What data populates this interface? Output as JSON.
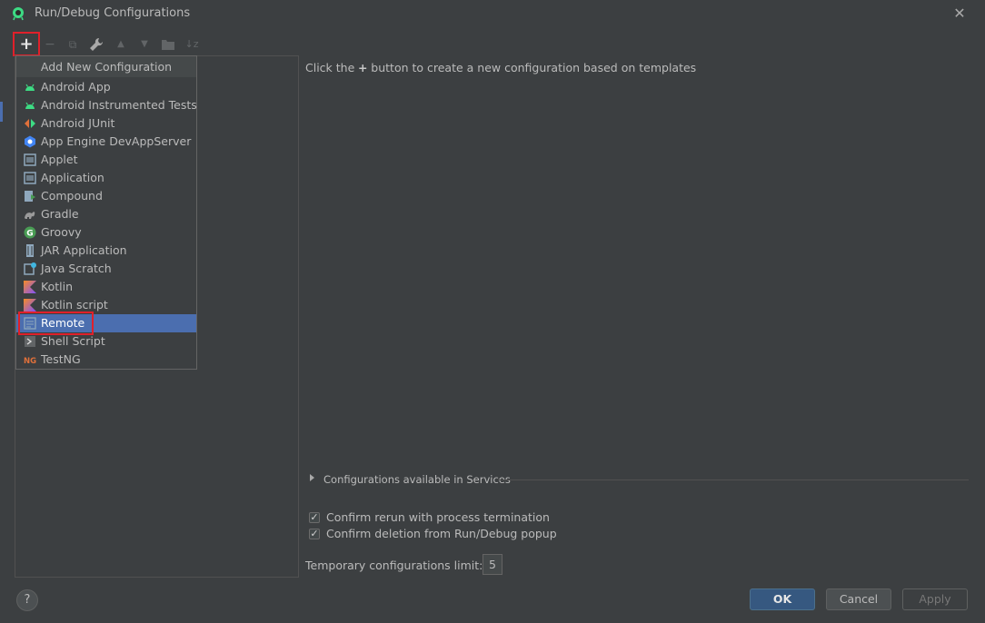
{
  "window": {
    "title": "Run/Debug Configurations",
    "close_glyph": "✕"
  },
  "toolbar": {
    "add": "+",
    "remove": "−",
    "copy": "⧉",
    "edit_templates": "🔧",
    "move_up": "▲",
    "move_down": "▼",
    "folder": "📁",
    "sort": "↓z"
  },
  "popup": {
    "header": "Add New Configuration",
    "items": [
      {
        "label": "Android App",
        "icon": "android-icon",
        "color": "#3ddc84"
      },
      {
        "label": "Android Instrumented Tests",
        "icon": "android-test-icon",
        "color": "#3ddc84"
      },
      {
        "label": "Android JUnit",
        "icon": "junit-icon",
        "color": "#e0703a"
      },
      {
        "label": "App Engine DevAppServer",
        "icon": "app-engine-icon",
        "color": "#4285f4"
      },
      {
        "label": "Applet",
        "icon": "applet-icon",
        "color": "#8fa8bd"
      },
      {
        "label": "Application",
        "icon": "application-icon",
        "color": "#8fa8bd"
      },
      {
        "label": "Compound",
        "icon": "compound-icon",
        "color": "#8fa8bd"
      },
      {
        "label": "Gradle",
        "icon": "gradle-icon",
        "color": "#9a9a9a"
      },
      {
        "label": "Groovy",
        "icon": "groovy-icon",
        "color": "#499c54"
      },
      {
        "label": "JAR Application",
        "icon": "jar-icon",
        "color": "#8fa8bd"
      },
      {
        "label": "Java Scratch",
        "icon": "java-scratch-icon",
        "color": "#8fa8bd"
      },
      {
        "label": "Kotlin",
        "icon": "kotlin-icon",
        "color": "#f88a25"
      },
      {
        "label": "Kotlin script",
        "icon": "kotlin-script-icon",
        "color": "#f88a25"
      },
      {
        "label": "Remote",
        "icon": "remote-icon",
        "color": "#8fa8bd",
        "selected": true
      },
      {
        "label": "Shell Script",
        "icon": "shell-script-icon",
        "color": "#9a9a9a"
      },
      {
        "label": "TestNG",
        "icon": "testng-icon",
        "color": "#e0703a"
      }
    ]
  },
  "main": {
    "hint_before": "Click the",
    "hint_plus": "+",
    "hint_after": "button to create a new configuration based on templates",
    "services_label": "Configurations available in Services",
    "confirm_rerun": "Confirm rerun with process termination",
    "confirm_deletion": "Confirm deletion from Run/Debug popup",
    "checkbox_mark": "✓",
    "limit_label": "Temporary configurations limit:",
    "limit_value": "5"
  },
  "footer": {
    "help": "?",
    "ok": "OK",
    "cancel": "Cancel",
    "apply": "Apply"
  }
}
